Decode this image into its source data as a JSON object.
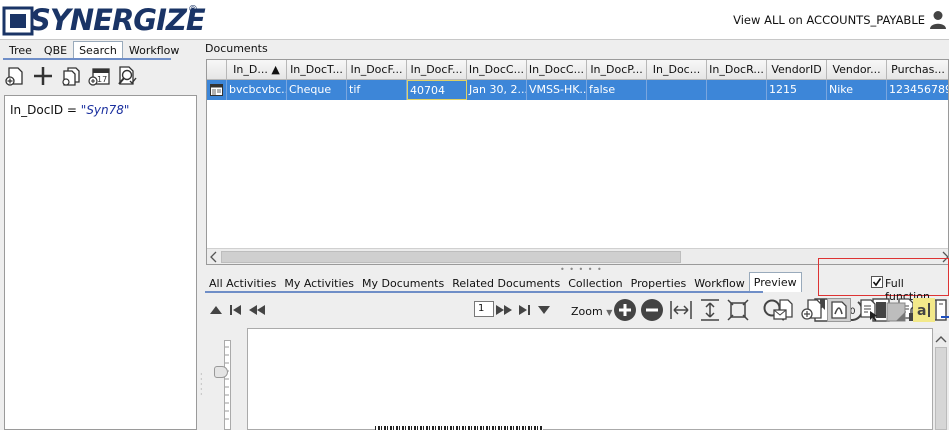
{
  "app": {
    "logo_text": "SYNERGIZE",
    "logo_reg": "®",
    "view_text": "View ALL on ACCOUNTS_PAYABLE",
    "user_icon": "user-icon"
  },
  "left": {
    "tabs": [
      {
        "label": "Tree"
      },
      {
        "label": "QBE"
      },
      {
        "label": "Search"
      },
      {
        "label": "Workflow"
      }
    ],
    "active_tab": "Search",
    "tools": [
      "new-document-icon",
      "add-icon",
      "documents-icon",
      "calendar-icon",
      "find-document-icon"
    ],
    "calendar_day": "17",
    "query": {
      "field": "In_DocID",
      "op": " = ",
      "value": "\"Syn78\""
    }
  },
  "documents": {
    "label": "Documents",
    "columns": [
      "In_D... ▲",
      "In_DocT...",
      "In_DocF...",
      "In_DocF...",
      "In_DocC...",
      "In_DocC...",
      "In_DocP...",
      "In_Doc...",
      "In_DocR...",
      "VendorID",
      "Vendor...",
      "Purchas..."
    ],
    "rows": [
      [
        "bvcbcvbc...",
        "Cheque",
        "tif",
        "40704",
        "Jan 30, 2...",
        "VMSS-HK...",
        "false",
        "",
        "",
        "1215",
        "Nike",
        "123456789"
      ]
    ]
  },
  "bottom_tabs": [
    {
      "label": "All Activities"
    },
    {
      "label": "My Activities"
    },
    {
      "label": "My Documents"
    },
    {
      "label": "Related Documents"
    },
    {
      "label": "Collection"
    },
    {
      "label": "Properties"
    },
    {
      "label": "Workflow"
    },
    {
      "label": "Preview"
    }
  ],
  "active_bottom_tab": "Preview",
  "full_function": {
    "label": "Full function",
    "checked": true
  },
  "preview_toolbar": {
    "page": "1",
    "zoom_label": "Zoom",
    "rotate_label": "90"
  },
  "colors": {
    "selection": "#3d86d8",
    "logo": "#1a3466",
    "highlight_border": "#dd3333"
  }
}
